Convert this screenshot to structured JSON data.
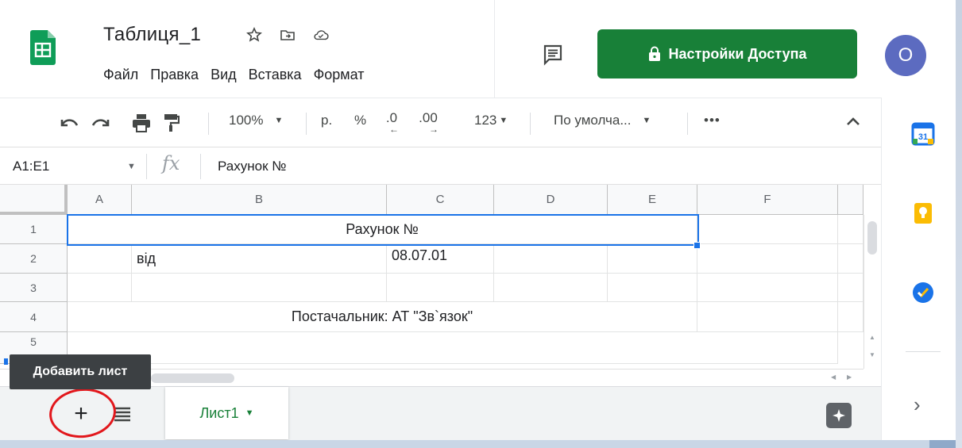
{
  "header": {
    "doc_title": "Таблиця_1",
    "menu": [
      "Файл",
      "Правка",
      "Вид",
      "Вставка",
      "Формат"
    ],
    "share_label": "Настройки Доступа",
    "avatar_letter": "O",
    "icons": [
      "sheets-logo",
      "star-icon",
      "move-folder-icon",
      "cloud-saved-icon",
      "comments-icon",
      "lock-icon"
    ]
  },
  "toolbar": {
    "zoom": "100%",
    "currency": "р.",
    "percent": "%",
    "dec_decrease": ".0",
    "dec_increase": ".00",
    "more_formats": "123",
    "font": "По умолча...",
    "more": "•••"
  },
  "formula_bar": {
    "name_box": "A1:E1",
    "fx": "fx",
    "formula": "Рахунок №"
  },
  "grid": {
    "columns": [
      "A",
      "B",
      "C",
      "D",
      "E",
      "F"
    ],
    "rows": [
      "1",
      "2",
      "3",
      "4",
      "5"
    ],
    "cells": {
      "merged_a1_e1": "Рахунок №",
      "b2": "від",
      "c2": "08.07.01",
      "merged_a4_e4": "Постачальник: АТ \"Зв`язок\""
    }
  },
  "sheets": {
    "tabs": [
      {
        "label": "Лист1",
        "active": true
      }
    ],
    "tooltip": "Добавить лист",
    "add_symbol": "+"
  },
  "colors": {
    "brand_green": "#188038",
    "selection_blue": "#1a73e8",
    "avatar": "#5c6bc0",
    "annotation_red": "#e2171c"
  }
}
